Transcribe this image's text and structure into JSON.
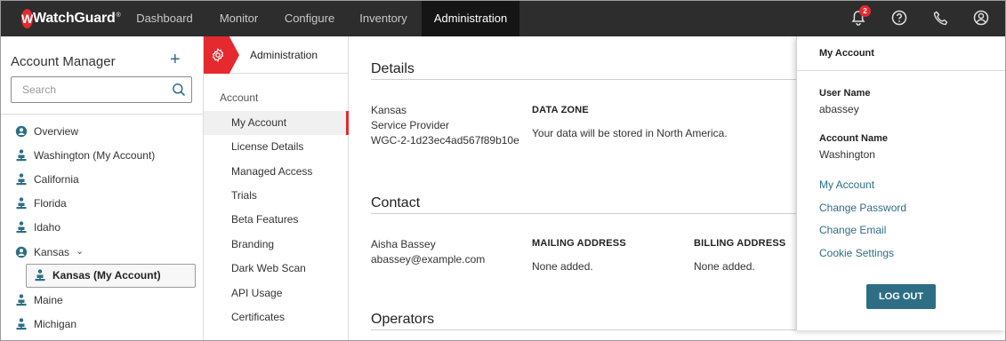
{
  "brand": {
    "logo_text": "WatchGuard",
    "logo_letter": "W",
    "trademark": "®",
    "accent": "#e5292f",
    "link_color": "#2d6e85"
  },
  "nav": {
    "tabs": [
      {
        "label": "Dashboard"
      },
      {
        "label": "Monitor"
      },
      {
        "label": "Configure"
      },
      {
        "label": "Inventory"
      },
      {
        "label": "Administration",
        "active": true
      }
    ],
    "notifications_count": "2",
    "icons": [
      "bell-icon",
      "help-icon",
      "phone-icon",
      "user-icon"
    ]
  },
  "account_manager": {
    "title": "Account Manager",
    "search_placeholder": "Search",
    "items": [
      {
        "label": "Overview",
        "icon": "globe-icon"
      },
      {
        "label": "Washington (My Account)",
        "icon": "account-tree-icon"
      },
      {
        "label": "California",
        "icon": "account-tree-icon"
      },
      {
        "label": "Florida",
        "icon": "account-tree-icon"
      },
      {
        "label": "Idaho",
        "icon": "account-tree-icon"
      },
      {
        "label": "Kansas",
        "icon": "globe-icon",
        "chevron": "⌄"
      },
      {
        "label": "Maine",
        "icon": "account-tree-icon"
      },
      {
        "label": "Michigan",
        "icon": "account-tree-icon"
      }
    ],
    "selected": {
      "label": "Kansas (My Account)",
      "icon": "account-tree-icon"
    }
  },
  "admin_menu": {
    "header": "Administration",
    "section": "Account",
    "items": [
      {
        "label": "My Account",
        "active": true
      },
      {
        "label": "License Details"
      },
      {
        "label": "Managed Access"
      },
      {
        "label": "Trials"
      },
      {
        "label": "Beta Features"
      },
      {
        "label": "Branding"
      },
      {
        "label": "Dark Web Scan"
      },
      {
        "label": "API Usage"
      },
      {
        "label": "Certificates"
      }
    ]
  },
  "details": {
    "heading": "Details",
    "account_name": "Kansas",
    "account_type": "Service Provider",
    "account_id": "WGC-2-1d23ec4ad567f89b10e",
    "data_zone_label": "DATA ZONE",
    "data_zone_value": "Your data will be stored in North America."
  },
  "contact": {
    "heading": "Contact",
    "name": "Aisha Bassey",
    "email": "abassey@example.com",
    "mailing_label": "MAILING ADDRESS",
    "mailing_value": "None added.",
    "billing_label": "BILLING ADDRESS",
    "billing_value": "None added."
  },
  "operators": {
    "heading": "Operators"
  },
  "account_panel": {
    "title": "My Account",
    "user_name_label": "User Name",
    "user_name_value": "abassey",
    "account_name_label": "Account Name",
    "account_name_value": "Washington",
    "links": [
      "My Account",
      "Change Password",
      "Change Email",
      "Cookie Settings"
    ],
    "logout_label": "LOG OUT"
  }
}
